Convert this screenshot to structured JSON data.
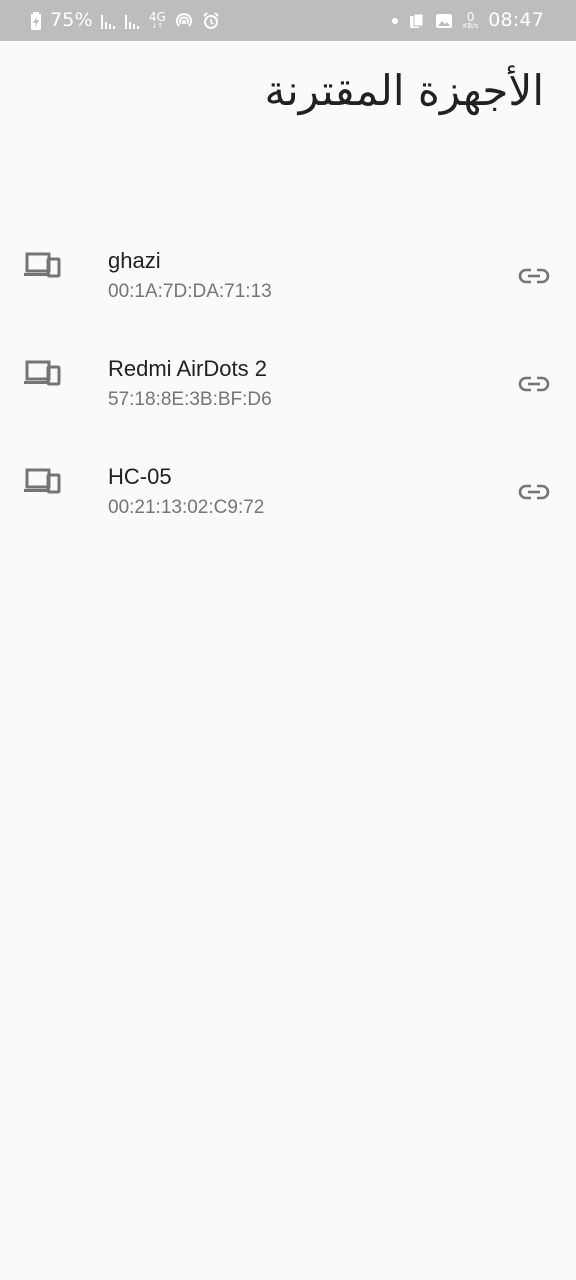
{
  "status_bar": {
    "battery_percent": "75%",
    "network_type": "4G",
    "data_speed_value": "0",
    "data_speed_unit": "KB/s",
    "time": "08:47"
  },
  "page": {
    "title": "الأجهزة المقترنة"
  },
  "devices": [
    {
      "name": "ghazi",
      "address": "00:1A:7D:DA:71:13",
      "icon": "devices-icon",
      "action_icon": "link-icon"
    },
    {
      "name": "Redmi AirDots 2",
      "address": "57:18:8E:3B:BF:D6",
      "icon": "devices-icon",
      "action_icon": "link-icon"
    },
    {
      "name": "HC-05",
      "address": "00:21:13:02:C9:72",
      "icon": "devices-icon",
      "action_icon": "link-icon"
    }
  ],
  "colors": {
    "status_bar_bg": "#bdbdbd",
    "background": "#fafafa",
    "primary_text": "#212121",
    "secondary_text": "#757575",
    "icon": "#757575"
  }
}
